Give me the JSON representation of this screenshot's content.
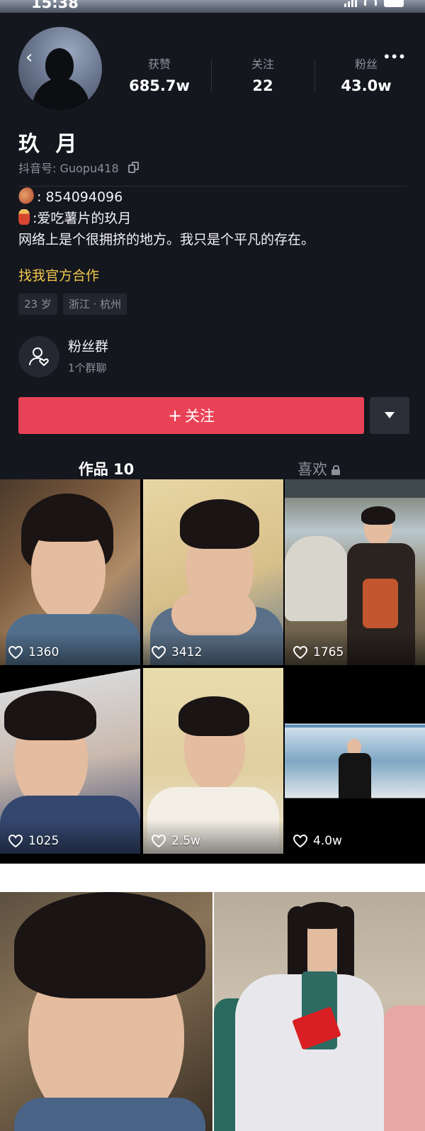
{
  "status": {
    "time": "15:38"
  },
  "profile": {
    "name": "玖 月",
    "douyin_id": "抖音号: Guopu418",
    "stats": [
      {
        "label": "获赞",
        "value": "685.7w"
      },
      {
        "label": "关注",
        "value": "22"
      },
      {
        "label": "粉丝",
        "value": "43.0w"
      }
    ],
    "bio": {
      "line1": ": 854094096",
      "line2": ":爱吃薯片的玖月",
      "line3": "网络上是个很拥挤的地方。我只是个平凡的存在。",
      "link": "找我官方合作"
    },
    "tags": [
      "23 岁",
      "浙江 · 杭州"
    ]
  },
  "fan_group": {
    "title": "粉丝群",
    "subtitle": "1个群聊"
  },
  "actions": {
    "follow_label": "关注"
  },
  "tabs": {
    "works": "作品 10",
    "likes": "喜欢"
  },
  "videos": [
    {
      "likes": "1360"
    },
    {
      "likes": "3412"
    },
    {
      "likes": "1765"
    },
    {
      "likes": "1025"
    },
    {
      "likes": "2.5w"
    },
    {
      "likes": "4.0w"
    }
  ],
  "colors": {
    "background": "#15171f",
    "follow_button": "#e94257",
    "accent_link": "#f2c94c",
    "muted_text": "#8d909a"
  },
  "icons": [
    "back-icon",
    "more-icon",
    "copy-icon",
    "fan-group-icon",
    "dropdown-icon",
    "lock-icon",
    "heart-icon"
  ]
}
